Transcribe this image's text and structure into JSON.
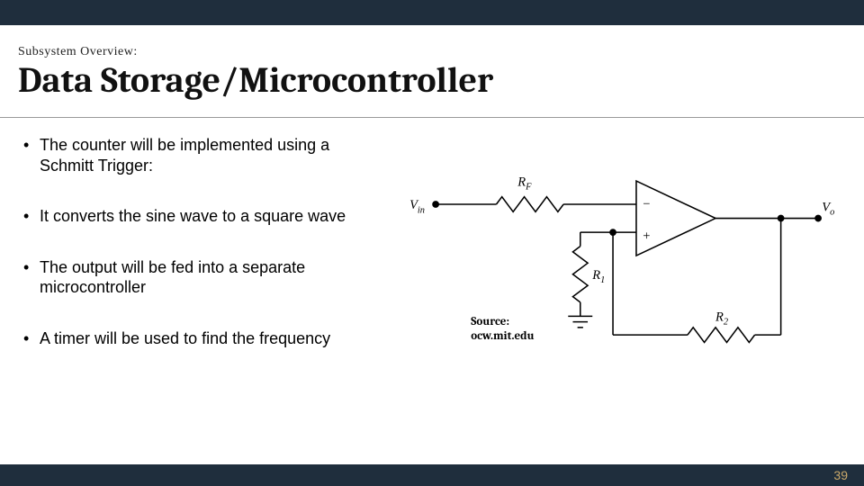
{
  "header": {
    "subtitle": "Subsystem Overview:",
    "title": "Data Storage/Microcontroller"
  },
  "bullets": [
    "The counter will be implemented using a Schmitt Trigger:",
    "It converts the sine wave to a square wave",
    "The output will be fed into a separate microcontroller",
    "A timer will be used to find the frequency"
  ],
  "diagram": {
    "labels": {
      "vin": "V",
      "vin_sub": "in",
      "rf": "R",
      "rf_sub": "F",
      "r1": "R",
      "r1_sub": "1",
      "r2": "R",
      "r2_sub": "2",
      "vo": "V",
      "vo_sub": "o",
      "minus": "−",
      "plus": "+"
    },
    "source_label": "Source:",
    "source_value": "ocw.mit.edu"
  },
  "page_number": "39"
}
